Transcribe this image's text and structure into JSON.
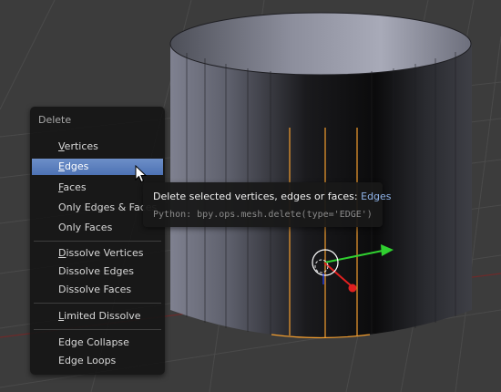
{
  "menu": {
    "title": "Delete",
    "items": [
      {
        "label": "Vertices",
        "underline": "V",
        "rest": "ertices"
      },
      {
        "label": "Edges",
        "underline": "E",
        "rest": "dges"
      },
      {
        "label": "Faces",
        "underline": "F",
        "rest": "aces"
      },
      {
        "label": "Only Edges & Faces",
        "underline": "",
        "rest": "Only Edges & Faces"
      },
      {
        "label": "Only Faces",
        "underline": "",
        "rest": "Only Faces"
      },
      {
        "label": "Dissolve Vertices",
        "underline": "D",
        "rest": "issolve Vertices"
      },
      {
        "label": "Dissolve Edges",
        "underline": "",
        "rest": "Dissolve Edges"
      },
      {
        "label": "Dissolve Faces",
        "underline": "",
        "rest": "Dissolve Faces"
      },
      {
        "label": "Limited Dissolve",
        "underline": "L",
        "rest": "imited Dissolve"
      },
      {
        "label": "Edge Collapse",
        "underline": "",
        "rest": "Edge Collapse"
      },
      {
        "label": "Edge Loops",
        "underline": "",
        "rest": "Edge Loops"
      }
    ],
    "active_item": "Edges"
  },
  "tooltip": {
    "description": "Delete selected vertices, edges or faces:",
    "value": "Edges",
    "python": "Python: bpy.ops.mesh.delete(type='EDGE')"
  },
  "colors": {
    "background": "#3c3c3c",
    "menu_highlight": "#5a7fc0",
    "selected_edge": "#f29d2e",
    "gizmo_x": "#e02020",
    "gizmo_y": "#30d030"
  }
}
